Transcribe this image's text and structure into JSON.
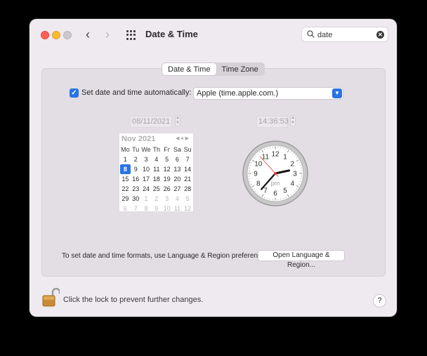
{
  "window": {
    "title": "Date & Time",
    "back_glyph": "‹",
    "forward_glyph": "›"
  },
  "search": {
    "value": "date",
    "placeholder": "Search"
  },
  "tabs": [
    {
      "label": "Date & Time",
      "active": true
    },
    {
      "label": "Time Zone",
      "active": false
    }
  ],
  "auto": {
    "checked": true,
    "label": "Set date and time automatically:",
    "server": "Apple (time.apple.com.)"
  },
  "date_field": "08/11/2021",
  "time_field": "14:36:53",
  "calendar": {
    "month": "Nov 2021",
    "weekdays": [
      "Mo",
      "Tu",
      "We",
      "Th",
      "Fr",
      "Sa",
      "Su"
    ],
    "weeks": [
      [
        "1",
        "2",
        "3",
        "4",
        "5",
        "6",
        "7"
      ],
      [
        "8",
        "9",
        "10",
        "11",
        "12",
        "13",
        "14"
      ],
      [
        "15",
        "16",
        "17",
        "18",
        "19",
        "20",
        "21"
      ],
      [
        "22",
        "23",
        "24",
        "25",
        "26",
        "27",
        "28"
      ],
      [
        "29",
        "30",
        "1",
        "2",
        "3",
        "4",
        "5"
      ],
      [
        "6",
        "7",
        "8",
        "9",
        "10",
        "11",
        "12"
      ]
    ],
    "selected": "8"
  },
  "clock": {
    "ampm": "pm",
    "hours": 14,
    "minutes": 36,
    "seconds": 53,
    "numbers": [
      "12",
      "1",
      "2",
      "3",
      "4",
      "5",
      "6",
      "7",
      "8",
      "9",
      "10",
      "11"
    ]
  },
  "formats": {
    "text": "To set date and time formats, use Language & Region preferences.",
    "button": "Open Language & Region..."
  },
  "lock": {
    "text": "Click the lock to prevent further changes."
  },
  "help": {
    "label": "?"
  },
  "colors": {
    "accent": "#2a74e3",
    "second_hand": "#e0463d"
  }
}
